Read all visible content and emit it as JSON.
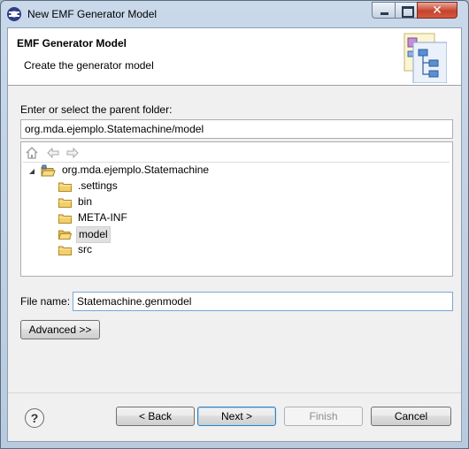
{
  "window": {
    "title": "New EMF Generator Model",
    "icon": "eclipse-icon",
    "controls": {
      "minimize": "minimize-icon",
      "maximize": "maximize-icon",
      "close_glyph": "✕"
    }
  },
  "header": {
    "title": "EMF Generator Model",
    "subtitle": "Create the generator model",
    "graphic": "generator-model-wizard-icon"
  },
  "parent_folder": {
    "label": "Enter or select the parent folder:",
    "value": "org.mda.ejemplo.Statemachine/model"
  },
  "tree_toolbar": {
    "icons": [
      "home-icon",
      "back-arrow-icon",
      "forward-arrow-icon"
    ]
  },
  "tree": {
    "root": {
      "label": "org.mda.ejemplo.Statemachine",
      "expanded": true,
      "icon": "open-project-folder-icon"
    },
    "children": [
      {
        "label": ".settings",
        "selected": false
      },
      {
        "label": "bin",
        "selected": false
      },
      {
        "label": "META-INF",
        "selected": false
      },
      {
        "label": "model",
        "selected": true
      },
      {
        "label": "src",
        "selected": false
      }
    ]
  },
  "file_name": {
    "label": "File name:",
    "value": "Statemachine.genmodel"
  },
  "advanced_button": "Advanced >>",
  "footer": {
    "help_glyph": "?",
    "back": "< Back",
    "next": "Next >",
    "finish": "Finish",
    "cancel": "Cancel"
  }
}
